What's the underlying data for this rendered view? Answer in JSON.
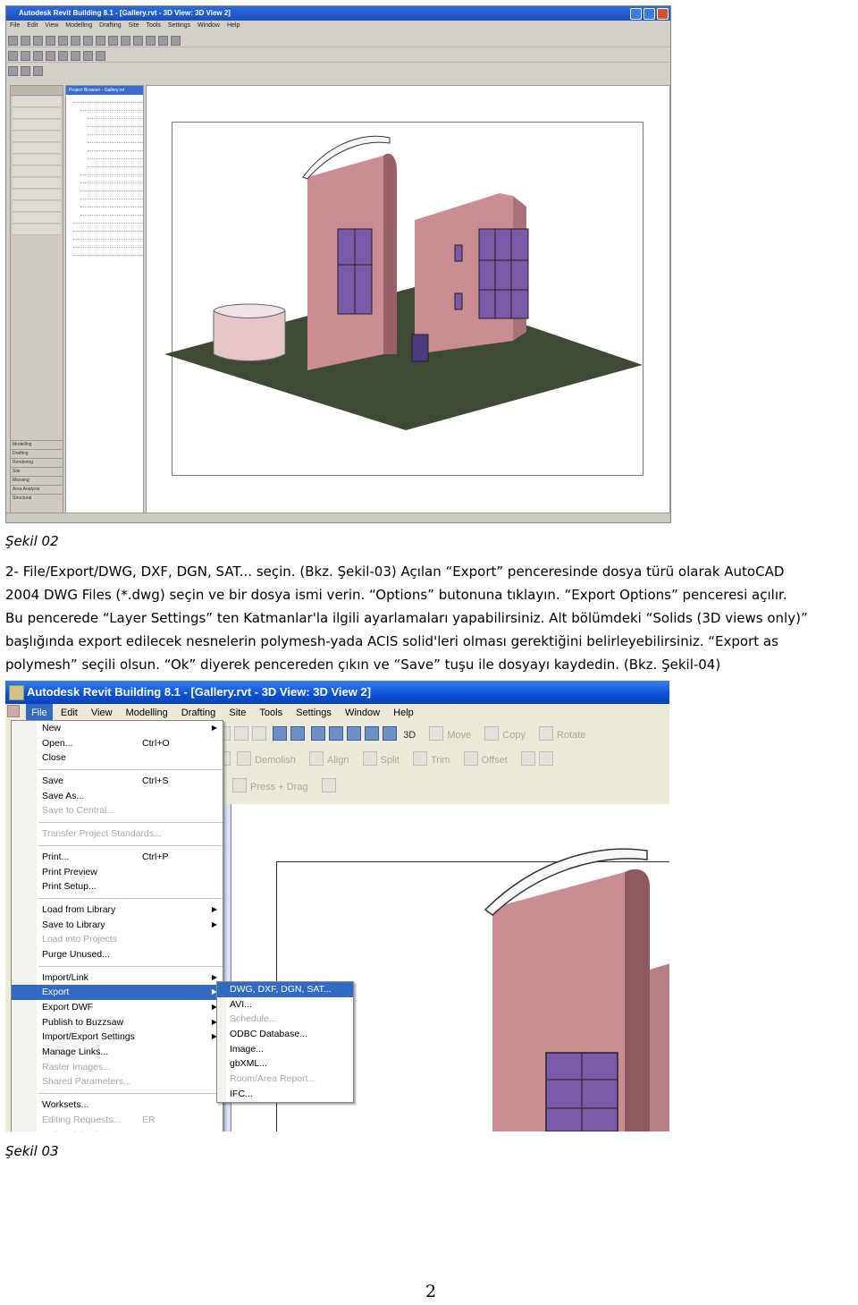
{
  "figure1": {
    "caption": "Şekil 02",
    "window_title": "Autodesk Revit Building 8.1 - [Gallery.rvt - 3D View: 3D View 2]",
    "menus": [
      "File",
      "Edit",
      "View",
      "Modelling",
      "Drafting",
      "Site",
      "Tools",
      "Settings",
      "Window",
      "Help"
    ],
    "browser_header": "Project Browser - Gallery.rvt",
    "sidebar_tabs": [
      "Modelling",
      "Drafting",
      "Rendering",
      "Site",
      "Massing",
      "Area Analysis",
      "Structural"
    ]
  },
  "paragraph": {
    "lines": [
      "2- File/Export/DWG, DXF, DGN, SAT... seçin. (Bkz. Şekil-03) Açılan “Export” penceresinde dosya türü olarak AutoCAD",
      "2004 DWG Files (*.dwg) seçin ve bir dosya ismi verin. “Options” butonuna tıklayın. “Export Options” penceresi açılır.",
      "Bu pencerede “Layer Settings” ten Katmanlar'la ilgili ayarlamaları yapabilirsiniz. Alt bölümdeki “Solids (3D views only)”",
      "başlığında export edilecek nesnelerin polymesh-yada ACIS solid'leri olması gerektiğini belirleyebilirsiniz. “Export as",
      "polymesh” seçili olsun. “Ok” diyerek pencereden çıkın ve “Save” tuşu ile dosyayı kaydedin. (Bkz. Şekil-04)"
    ]
  },
  "figure2": {
    "caption": "Şekil 03",
    "window_title": "Autodesk Revit Building 8.1 - [Gallery.rvt - 3D View: 3D View 2]",
    "menus": [
      "File",
      "Edit",
      "View",
      "Modelling",
      "Drafting",
      "Site",
      "Tools",
      "Settings",
      "Window",
      "Help"
    ],
    "toolbar": {
      "row1": [
        "3D",
        "Move",
        "Copy",
        "Rotate"
      ],
      "row2": [
        "Demolish",
        "Align",
        "Split",
        "Trim",
        "Offset"
      ],
      "row3": [
        "Press + Drag"
      ]
    },
    "file_menu": [
      {
        "label": "New",
        "shortcut": "",
        "arrow": true,
        "disabled": false
      },
      {
        "label": "Open...",
        "shortcut": "Ctrl+O",
        "arrow": false,
        "disabled": false
      },
      {
        "label": "Close",
        "shortcut": "",
        "arrow": false,
        "disabled": false
      },
      {
        "sep": true
      },
      {
        "label": "Save",
        "shortcut": "Ctrl+S",
        "arrow": false,
        "disabled": false
      },
      {
        "label": "Save As...",
        "shortcut": "",
        "arrow": false,
        "disabled": false
      },
      {
        "label": "Save to Central...",
        "shortcut": "",
        "arrow": false,
        "disabled": true
      },
      {
        "sep": true
      },
      {
        "label": "Transfer Project Standards...",
        "shortcut": "",
        "arrow": false,
        "disabled": true
      },
      {
        "sep": true
      },
      {
        "label": "Print...",
        "shortcut": "Ctrl+P",
        "arrow": false,
        "disabled": false
      },
      {
        "label": "Print Preview",
        "shortcut": "",
        "arrow": false,
        "disabled": false
      },
      {
        "label": "Print Setup...",
        "shortcut": "",
        "arrow": false,
        "disabled": false
      },
      {
        "sep": true
      },
      {
        "label": "Load from Library",
        "shortcut": "",
        "arrow": true,
        "disabled": false
      },
      {
        "label": "Save to Library",
        "shortcut": "",
        "arrow": true,
        "disabled": false
      },
      {
        "label": "Load into Projects",
        "shortcut": "",
        "arrow": false,
        "disabled": true
      },
      {
        "label": "Purge Unused...",
        "shortcut": "",
        "arrow": false,
        "disabled": false
      },
      {
        "sep": true
      },
      {
        "label": "Import/Link",
        "shortcut": "",
        "arrow": true,
        "disabled": false
      },
      {
        "label": "Export",
        "shortcut": "",
        "arrow": true,
        "disabled": false,
        "selected": true
      },
      {
        "label": "Export DWF",
        "shortcut": "",
        "arrow": true,
        "disabled": false
      },
      {
        "label": "Publish to Buzzsaw",
        "shortcut": "",
        "arrow": true,
        "disabled": false
      },
      {
        "label": "Import/Export Settings",
        "shortcut": "",
        "arrow": true,
        "disabled": false
      },
      {
        "label": "Manage Links...",
        "shortcut": "",
        "arrow": false,
        "disabled": false
      },
      {
        "label": "Raster Images...",
        "shortcut": "",
        "arrow": false,
        "disabled": true
      },
      {
        "label": "Shared Parameters...",
        "shortcut": "",
        "arrow": false,
        "disabled": true
      },
      {
        "sep": true
      },
      {
        "label": "Worksets...",
        "shortcut": "",
        "arrow": false,
        "disabled": false
      },
      {
        "label": "Editing Requests...",
        "shortcut": "ER",
        "arrow": false,
        "disabled": true
      },
      {
        "label": "Relinquish All Mine",
        "shortcut": "",
        "arrow": false,
        "disabled": true
      }
    ],
    "export_submenu": [
      {
        "label": "DWG, DXF, DGN, SAT...",
        "selected": true,
        "disabled": false
      },
      {
        "label": "AVI...",
        "disabled": false
      },
      {
        "label": "Schedule...",
        "disabled": true
      },
      {
        "label": "ODBC Database...",
        "disabled": false
      },
      {
        "label": "Image...",
        "disabled": false
      },
      {
        "label": "gbXML...",
        "disabled": false
      },
      {
        "label": "Room/Area Report...",
        "disabled": true
      },
      {
        "label": "IFC...",
        "disabled": false
      }
    ]
  },
  "page_number": "2",
  "colors": {
    "xp_title_blue": "#0a50d8",
    "menu_highlight": "#316ac5",
    "building_wall": "#c98d92",
    "building_shadow": "#8e5a60",
    "window_glass": "#7a5aa8",
    "ground": "#3f4a34"
  }
}
